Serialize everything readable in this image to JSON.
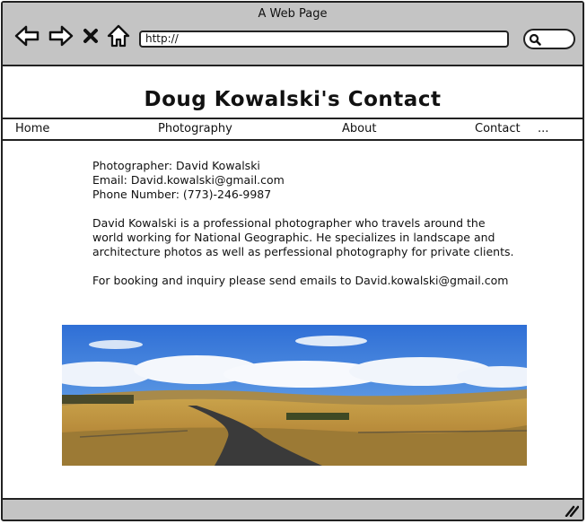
{
  "window": {
    "title": "A Web Page"
  },
  "toolbar": {
    "url": "http://",
    "back_icon": "back-arrow-icon",
    "forward_icon": "forward-arrow-icon",
    "stop_icon": "close-icon",
    "home_icon": "home-icon",
    "search_icon": "search-icon"
  },
  "page": {
    "title": "Doug Kowalski's Contact"
  },
  "nav": {
    "items": [
      "Home",
      "Photography",
      "About",
      "Contact",
      "..."
    ]
  },
  "contact": {
    "photographer": "Photographer: David Kowalski",
    "email": "Email: David.kowalski@gmail.com",
    "phone": "Phone Number: (773)-246-9987",
    "bio": "David Kowalski is a professional photographer who travels around the world working for National Geographic. He specializes in landscape and architecture photos as well as perfessional photography for private clients.",
    "booking": "For booking and inquiry please send emails to David.kowalski@gmail.com"
  },
  "colors": {
    "chrome": "#c4c4c4",
    "border": "#222222",
    "sky": "#3a78d8",
    "field": "#c9a24a"
  }
}
